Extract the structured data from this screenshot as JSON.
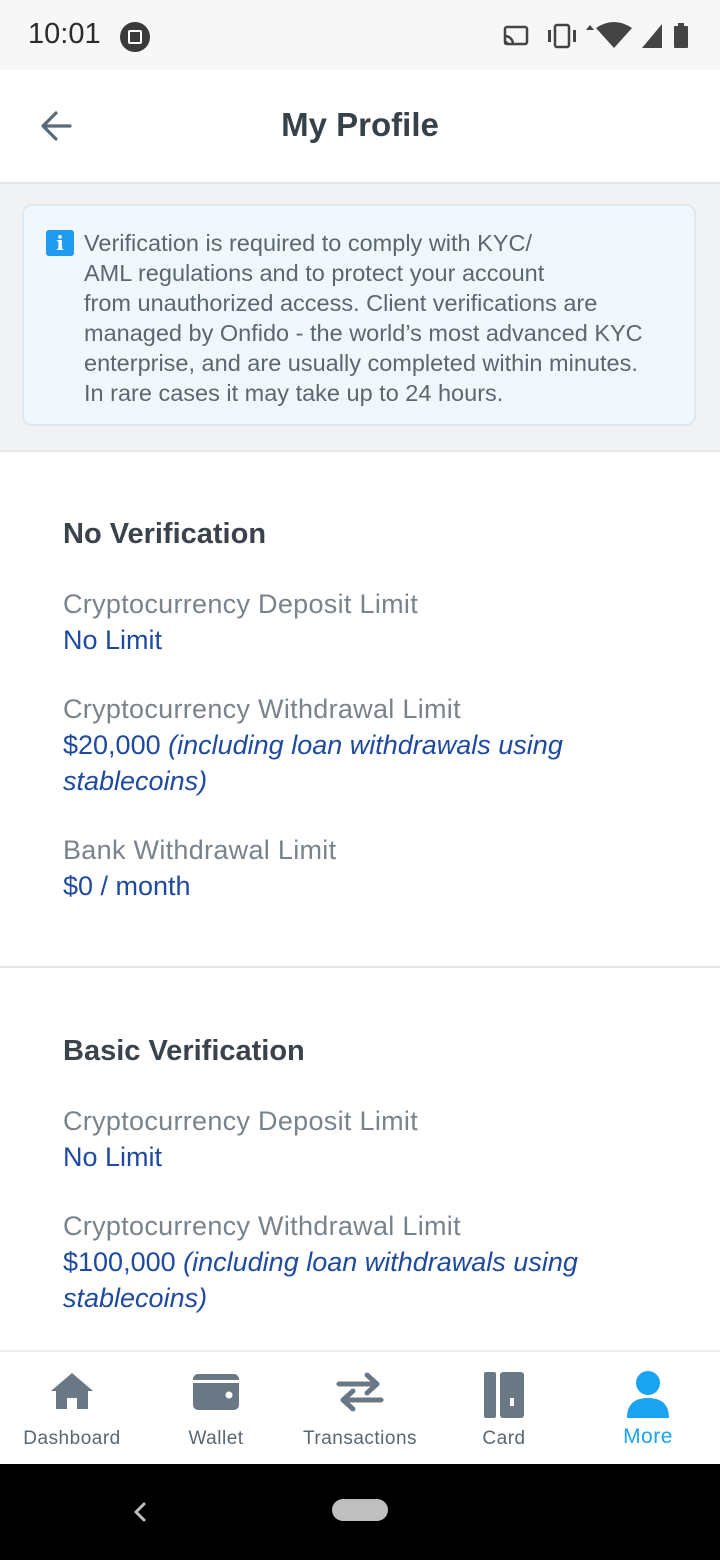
{
  "status_bar": {
    "time": "10:01"
  },
  "header": {
    "title": "My Profile"
  },
  "info": {
    "lines": [
      "Verification is required to comply with KYC/",
      "AML regulations and to protect your account",
      "from unauthorized access. Client verifications are",
      "managed by Onfido - the world’s most advanced KYC",
      "enterprise, and are usually completed within minutes.",
      "In rare cases it may take up to 24 hours."
    ]
  },
  "sections": [
    {
      "title": "No Verification",
      "limits": [
        {
          "label": "Cryptocurrency Deposit Limit",
          "value": "No Limit",
          "note": ""
        },
        {
          "label": "Cryptocurrency Withdrawal Limit",
          "value": "$20,000",
          "note": "(including loan withdrawals using stablecoins)"
        },
        {
          "label": "Bank Withdrawal Limit",
          "value": "$0 / month",
          "note": ""
        }
      ]
    },
    {
      "title": "Basic Verification",
      "limits": [
        {
          "label": "Cryptocurrency Deposit Limit",
          "value": "No Limit",
          "note": ""
        },
        {
          "label": "Cryptocurrency Withdrawal Limit",
          "value": "$100,000",
          "note": "(including loan withdrawals using stablecoins)"
        }
      ]
    }
  ],
  "bottom_nav": {
    "items": [
      {
        "label": "Dashboard",
        "icon": "home-icon"
      },
      {
        "label": "Wallet",
        "icon": "wallet-icon"
      },
      {
        "label": "Transactions",
        "icon": "transfer-arrows-icon"
      },
      {
        "label": "Card",
        "icon": "card-icon"
      },
      {
        "label": "More",
        "icon": "user-icon",
        "active": true
      }
    ]
  },
  "colors": {
    "accent": "#1aa3f0",
    "value_text": "#1e4aa0",
    "info_bg": "#f1f8fd"
  }
}
